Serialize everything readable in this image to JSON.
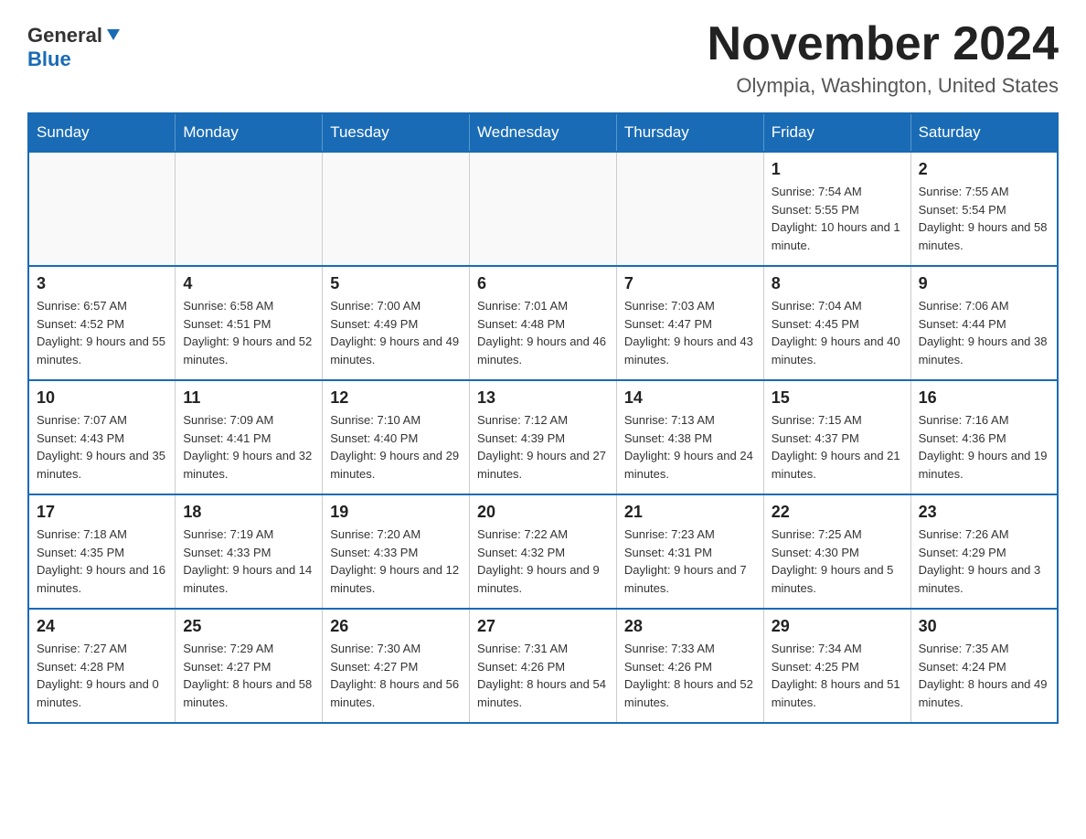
{
  "header": {
    "logo_general": "General",
    "logo_blue": "Blue",
    "month_title": "November 2024",
    "location": "Olympia, Washington, United States"
  },
  "weekdays": [
    "Sunday",
    "Monday",
    "Tuesday",
    "Wednesday",
    "Thursday",
    "Friday",
    "Saturday"
  ],
  "rows": [
    [
      {
        "day": "",
        "info": ""
      },
      {
        "day": "",
        "info": ""
      },
      {
        "day": "",
        "info": ""
      },
      {
        "day": "",
        "info": ""
      },
      {
        "day": "",
        "info": ""
      },
      {
        "day": "1",
        "info": "Sunrise: 7:54 AM\nSunset: 5:55 PM\nDaylight: 10 hours and 1 minute."
      },
      {
        "day": "2",
        "info": "Sunrise: 7:55 AM\nSunset: 5:54 PM\nDaylight: 9 hours and 58 minutes."
      }
    ],
    [
      {
        "day": "3",
        "info": "Sunrise: 6:57 AM\nSunset: 4:52 PM\nDaylight: 9 hours and 55 minutes."
      },
      {
        "day": "4",
        "info": "Sunrise: 6:58 AM\nSunset: 4:51 PM\nDaylight: 9 hours and 52 minutes."
      },
      {
        "day": "5",
        "info": "Sunrise: 7:00 AM\nSunset: 4:49 PM\nDaylight: 9 hours and 49 minutes."
      },
      {
        "day": "6",
        "info": "Sunrise: 7:01 AM\nSunset: 4:48 PM\nDaylight: 9 hours and 46 minutes."
      },
      {
        "day": "7",
        "info": "Sunrise: 7:03 AM\nSunset: 4:47 PM\nDaylight: 9 hours and 43 minutes."
      },
      {
        "day": "8",
        "info": "Sunrise: 7:04 AM\nSunset: 4:45 PM\nDaylight: 9 hours and 40 minutes."
      },
      {
        "day": "9",
        "info": "Sunrise: 7:06 AM\nSunset: 4:44 PM\nDaylight: 9 hours and 38 minutes."
      }
    ],
    [
      {
        "day": "10",
        "info": "Sunrise: 7:07 AM\nSunset: 4:43 PM\nDaylight: 9 hours and 35 minutes."
      },
      {
        "day": "11",
        "info": "Sunrise: 7:09 AM\nSunset: 4:41 PM\nDaylight: 9 hours and 32 minutes."
      },
      {
        "day": "12",
        "info": "Sunrise: 7:10 AM\nSunset: 4:40 PM\nDaylight: 9 hours and 29 minutes."
      },
      {
        "day": "13",
        "info": "Sunrise: 7:12 AM\nSunset: 4:39 PM\nDaylight: 9 hours and 27 minutes."
      },
      {
        "day": "14",
        "info": "Sunrise: 7:13 AM\nSunset: 4:38 PM\nDaylight: 9 hours and 24 minutes."
      },
      {
        "day": "15",
        "info": "Sunrise: 7:15 AM\nSunset: 4:37 PM\nDaylight: 9 hours and 21 minutes."
      },
      {
        "day": "16",
        "info": "Sunrise: 7:16 AM\nSunset: 4:36 PM\nDaylight: 9 hours and 19 minutes."
      }
    ],
    [
      {
        "day": "17",
        "info": "Sunrise: 7:18 AM\nSunset: 4:35 PM\nDaylight: 9 hours and 16 minutes."
      },
      {
        "day": "18",
        "info": "Sunrise: 7:19 AM\nSunset: 4:33 PM\nDaylight: 9 hours and 14 minutes."
      },
      {
        "day": "19",
        "info": "Sunrise: 7:20 AM\nSunset: 4:33 PM\nDaylight: 9 hours and 12 minutes."
      },
      {
        "day": "20",
        "info": "Sunrise: 7:22 AM\nSunset: 4:32 PM\nDaylight: 9 hours and 9 minutes."
      },
      {
        "day": "21",
        "info": "Sunrise: 7:23 AM\nSunset: 4:31 PM\nDaylight: 9 hours and 7 minutes."
      },
      {
        "day": "22",
        "info": "Sunrise: 7:25 AM\nSunset: 4:30 PM\nDaylight: 9 hours and 5 minutes."
      },
      {
        "day": "23",
        "info": "Sunrise: 7:26 AM\nSunset: 4:29 PM\nDaylight: 9 hours and 3 minutes."
      }
    ],
    [
      {
        "day": "24",
        "info": "Sunrise: 7:27 AM\nSunset: 4:28 PM\nDaylight: 9 hours and 0 minutes."
      },
      {
        "day": "25",
        "info": "Sunrise: 7:29 AM\nSunset: 4:27 PM\nDaylight: 8 hours and 58 minutes."
      },
      {
        "day": "26",
        "info": "Sunrise: 7:30 AM\nSunset: 4:27 PM\nDaylight: 8 hours and 56 minutes."
      },
      {
        "day": "27",
        "info": "Sunrise: 7:31 AM\nSunset: 4:26 PM\nDaylight: 8 hours and 54 minutes."
      },
      {
        "day": "28",
        "info": "Sunrise: 7:33 AM\nSunset: 4:26 PM\nDaylight: 8 hours and 52 minutes."
      },
      {
        "day": "29",
        "info": "Sunrise: 7:34 AM\nSunset: 4:25 PM\nDaylight: 8 hours and 51 minutes."
      },
      {
        "day": "30",
        "info": "Sunrise: 7:35 AM\nSunset: 4:24 PM\nDaylight: 8 hours and 49 minutes."
      }
    ]
  ]
}
